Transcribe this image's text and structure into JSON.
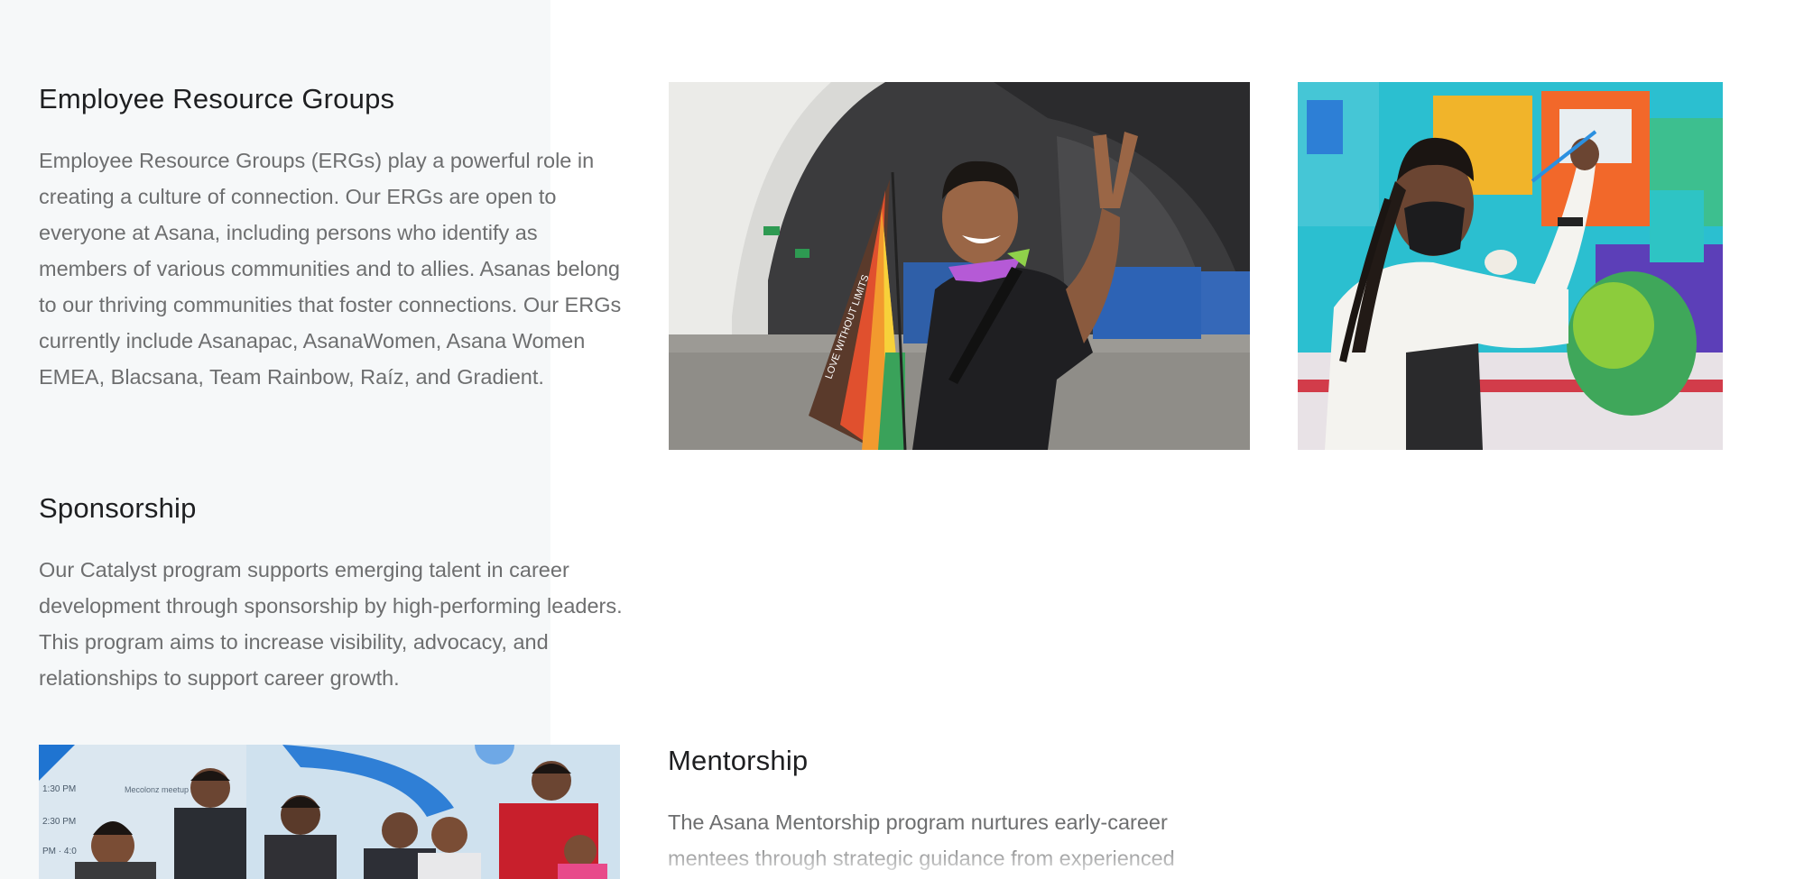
{
  "sections": {
    "erg": {
      "title": "Employee Resource Groups",
      "body": "Employee Resource Groups (ERGs) play a powerful role in creating a culture of connection. Our ERGs are open to everyone at Asana, including persons who identify as members of various communities and to allies. Asanas belong to our thriving communities that foster connections. Our ERGs currently include Asanapac, AsanaWomen, Asana Women EMEA, Blacsana, Team Rainbow, Raíz, and Gradient."
    },
    "sponsorship": {
      "title": "Sponsorship",
      "body": "Our Catalyst program supports emerging talent in career development through sponsorship by high-performing leaders. This program aims to increase visibility, advocacy, and relationships to support career growth."
    },
    "mentorship": {
      "title": "Mentorship",
      "body": "The Asana Mentorship program nurtures early-career mentees through strategic guidance from experienced"
    }
  },
  "photos": {
    "pride": {
      "flag_text": "LOVE WITHOUT LIMITS"
    },
    "group": {
      "screen_times": [
        "1:30 PM",
        "2:30 PM",
        "PM · 4:0"
      ],
      "screen_label": "Mecolonz meetup"
    }
  },
  "colors": {
    "panel_background": "#f6f8f9",
    "heading": "#1e1f21",
    "body_text": "#6d6e6f"
  }
}
